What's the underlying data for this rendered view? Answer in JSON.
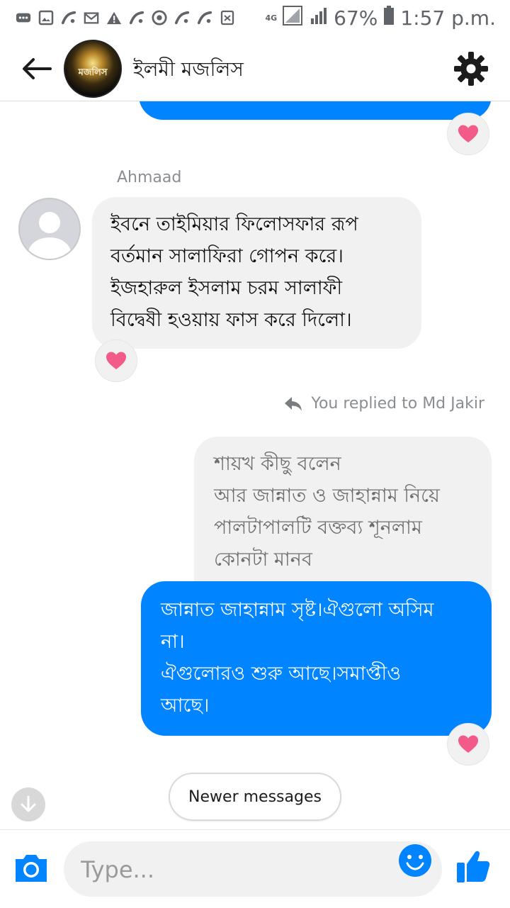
{
  "status_bar": {
    "network": "4G",
    "battery_percent": "67%",
    "time": "1:57 p.m."
  },
  "header": {
    "group_name": "ইলমী মজলিস",
    "avatar_text": "মজলিস"
  },
  "messages": {
    "incoming": {
      "sender": "Ahmaad",
      "lines": [
        "ইবনে তাইমিয়ার ফিলোসফার রূপ",
        "বর্তমান সালাফিরা গোপন করে।",
        "ইজহারুল ইসলাম চরম সালাফী",
        "বিদ্বেষী হওয়ায় ফাস করে দিলো।"
      ]
    },
    "reply_note": "You replied to Md Jakir",
    "quoted": {
      "lines": [
        "শায়খ কীছু বলেন",
        "আর জান্নাত ও জাহান্নাম নিয়ে",
        "পালটাপালটি বক্তব্য শূনলাম",
        "কোনটা মানব"
      ]
    },
    "outgoing": {
      "lines": [
        "জান্নাত জাহান্নাম সৃষ্ট।ঐগুলো অসিম",
        "না।",
        "ঐগুলোরও শুরু আছে।সমাপ্তীও",
        "আছে।"
      ]
    }
  },
  "newer_messages_label": "Newer messages",
  "composer": {
    "placeholder": "Type..."
  },
  "colors": {
    "messenger_blue": "#0084ff",
    "bubble_gray": "#f1f1f1",
    "heart_pink": "#f25a8a"
  }
}
